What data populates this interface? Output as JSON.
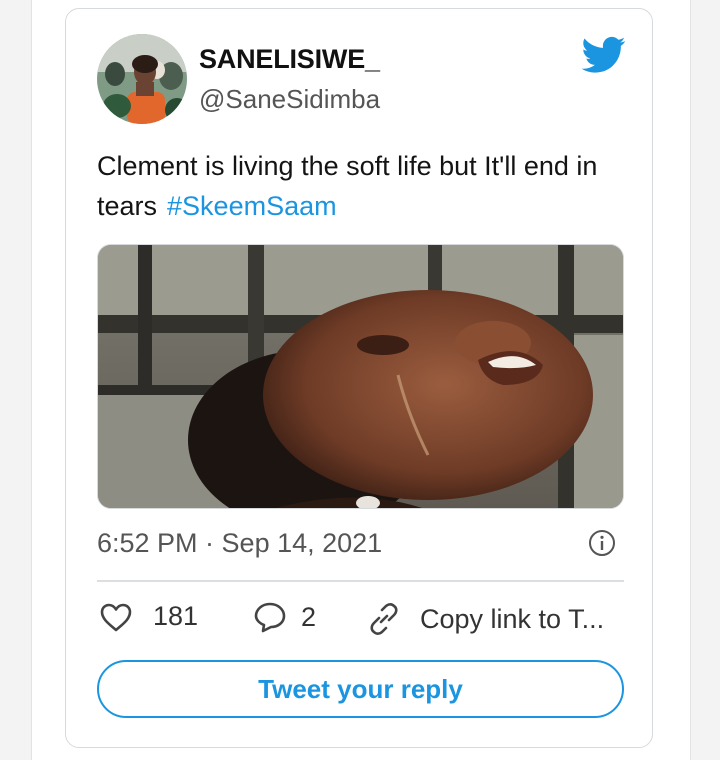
{
  "tweet": {
    "display_name": "SANELISIWE_",
    "handle": "@SaneSidimba",
    "text": "Clement is living the soft life but It'll end in tears",
    "hashtag": "#SkeemSaam",
    "timestamp": "6:52 PM · Sep 14, 2021",
    "likes": "181",
    "replies": "2",
    "copy_link": "Copy link to T...",
    "reply_button": "Tweet your reply"
  },
  "colors": {
    "accent": "#1b95e0",
    "text": "#141414",
    "muted": "#555555",
    "border": "#d6dadd"
  },
  "icons": [
    "avatar-photo",
    "twitter-bird-icon",
    "info-icon",
    "heart-icon",
    "reply-bubble-icon",
    "link-icon"
  ]
}
